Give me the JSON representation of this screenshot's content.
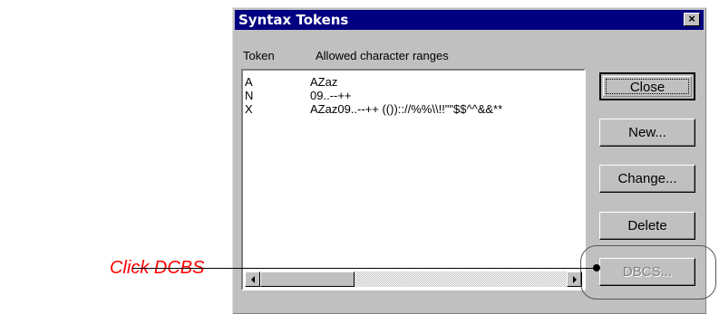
{
  "dialog": {
    "title": "Syntax Tokens",
    "close_glyph": "×"
  },
  "list": {
    "headers": {
      "token": "Token",
      "ranges": "Allowed character ranges"
    },
    "rows": [
      {
        "token": "A",
        "ranges": "AZaz"
      },
      {
        "token": "N",
        "ranges": "09..--++"
      },
      {
        "token": "X",
        "ranges": "AZaz09..--++ (()):://%%\\\\!!\"\"$$^^&&**"
      }
    ]
  },
  "buttons": {
    "close": "Close",
    "new": "New...",
    "change": "Change...",
    "delete": "Delete",
    "dbcs": "DBCS..."
  },
  "annotation": {
    "callout": "Click DCBS"
  },
  "colors": {
    "titlebar": "#000080",
    "dialog_face": "#c0c0c0",
    "callout_text": "#ff0000"
  },
  "icons": {
    "scroll_left": "triangle-left-icon",
    "scroll_right": "triangle-right-icon"
  }
}
